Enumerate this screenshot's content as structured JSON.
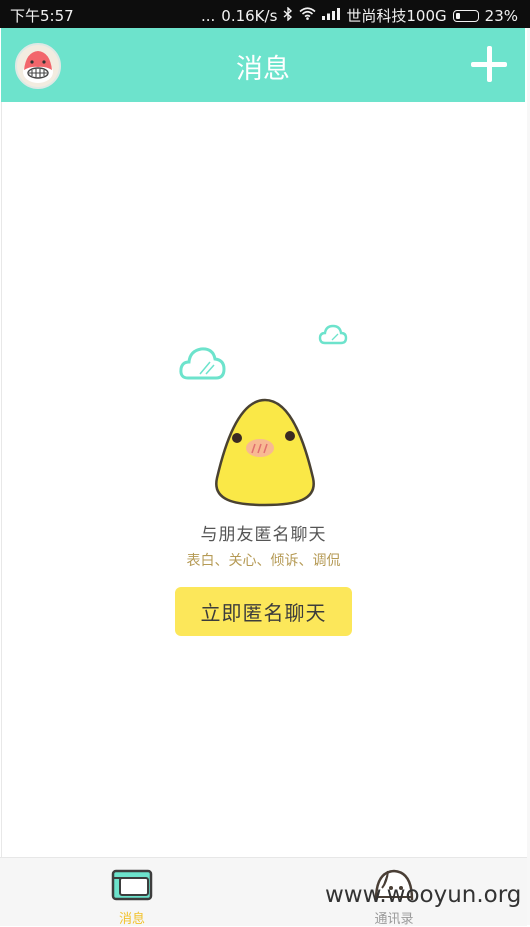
{
  "status_bar": {
    "time": "下午5:57",
    "dots": "...",
    "speed": "0.16K/s",
    "carrier": "世尚科技100G",
    "battery": "23%",
    "battery_level": 0.23
  },
  "header": {
    "title": "消息"
  },
  "empty_state": {
    "title": "与朋友匿名聊天",
    "subtitle": "表白、关心、倾诉、调侃",
    "button_label": "立即匿名聊天"
  },
  "tab_bar": {
    "tabs": [
      {
        "label": "消息",
        "active": true
      },
      {
        "label": "通讯录",
        "active": false
      }
    ]
  },
  "watermark": "www.wooyun.org",
  "colors": {
    "accent": "#6de3cc",
    "button": "#fce75a",
    "active_tab": "#f1c22c"
  }
}
